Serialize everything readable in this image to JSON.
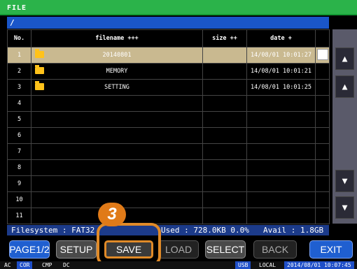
{
  "window": {
    "title": "FILE"
  },
  "path": "/",
  "table": {
    "headers": [
      "No.",
      "filename +++",
      "size ++",
      "date +"
    ],
    "rows": [
      {
        "no": "1",
        "name": "20140801",
        "size": "",
        "date": "14/08/01 10:01:27",
        "folder": true,
        "selected": true
      },
      {
        "no": "2",
        "name": "MEMORY",
        "size": "",
        "date": "14/08/01 10:01:21",
        "folder": true
      },
      {
        "no": "3",
        "name": "SETTING",
        "size": "",
        "date": "14/08/01 10:01:25",
        "folder": true
      },
      {
        "no": "4",
        "name": "",
        "size": "",
        "date": ""
      },
      {
        "no": "5",
        "name": "",
        "size": "",
        "date": ""
      },
      {
        "no": "6",
        "name": "",
        "size": "",
        "date": ""
      },
      {
        "no": "7",
        "name": "",
        "size": "",
        "date": ""
      },
      {
        "no": "8",
        "name": "",
        "size": "",
        "date": ""
      },
      {
        "no": "9",
        "name": "",
        "size": "",
        "date": ""
      },
      {
        "no": "10",
        "name": "",
        "size": "",
        "date": ""
      },
      {
        "no": "11",
        "name": "",
        "size": "",
        "date": ""
      }
    ]
  },
  "sidebar": {
    "icons": [
      "arrow-up-double",
      "arrow-up",
      "arrow-down",
      "arrow-down-double"
    ]
  },
  "status": {
    "filesystem": "Filesystem : FAT32",
    "used": "Used : 728.0KB  0.0%",
    "avail": "Avail : 1.8GB"
  },
  "buttons": {
    "page": "PAGE1/2",
    "setup": "SETUP",
    "save": "SAVE",
    "load": "LOAD",
    "select": "SELECT",
    "back": "BACK",
    "exit": "EXIT"
  },
  "bottom": {
    "ac": "AC",
    "cor": "COR",
    "cmp": "CMP",
    "dc": "DC",
    "usb": "USB",
    "local": "LOCAL",
    "datetime": "2014/08/01 10:07:45"
  },
  "callout": {
    "step": "3"
  },
  "colors": {
    "accent_green": "#2bb34a",
    "accent_blue": "#1f5fd0",
    "highlight_orange": "#e08a28"
  }
}
